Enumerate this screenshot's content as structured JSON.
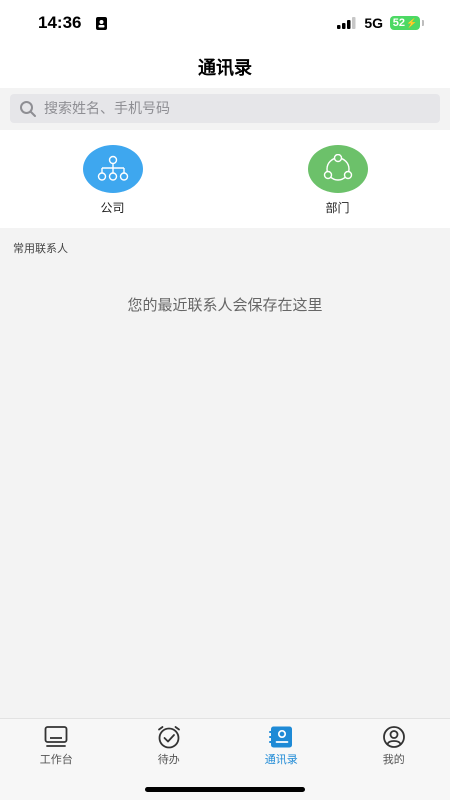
{
  "status_bar": {
    "time": "14:36",
    "network": "5G",
    "battery": "52"
  },
  "nav": {
    "title": "通讯录"
  },
  "search": {
    "placeholder": "搜索姓名、手机号码",
    "value": ""
  },
  "shortcuts": [
    {
      "label": "公司",
      "icon": "org-chart-icon",
      "color": "#3ea7ef"
    },
    {
      "label": "部门",
      "icon": "department-network-icon",
      "color": "#6cc16a"
    }
  ],
  "section": {
    "frequent_contacts": "常用联系人",
    "empty_message": "您的最近联系人会保存在这里"
  },
  "tabs": [
    {
      "label": "工作台",
      "icon": "monitor-icon",
      "active": false
    },
    {
      "label": "待办",
      "icon": "alarm-clock-icon",
      "active": false
    },
    {
      "label": "通讯录",
      "icon": "contacts-book-icon",
      "active": true
    },
    {
      "label": "我的",
      "icon": "user-profile-icon",
      "active": false
    }
  ],
  "colors": {
    "accent": "#1e8ad6",
    "battery": "#4cd964"
  }
}
